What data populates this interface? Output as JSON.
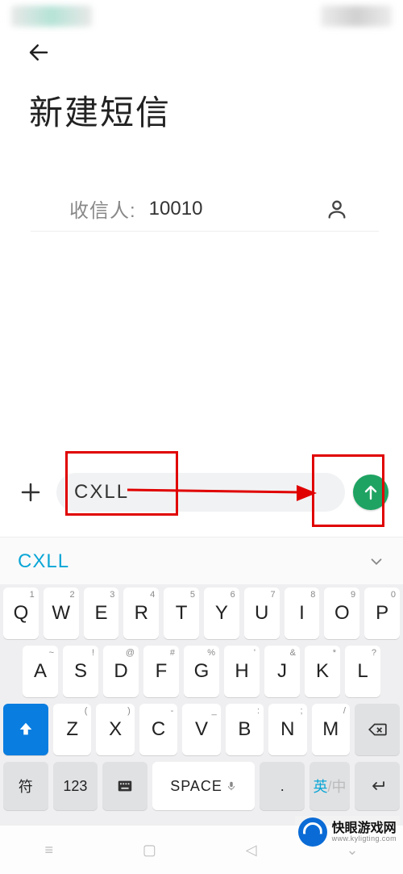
{
  "header": {
    "title": "新建短信"
  },
  "recipient": {
    "label": "收信人:",
    "value": "10010"
  },
  "compose": {
    "text": "CXLL"
  },
  "suggestion": {
    "text": "CXLL"
  },
  "keyboard": {
    "row1": [
      {
        "k": "Q",
        "m": "1"
      },
      {
        "k": "W",
        "m": "2"
      },
      {
        "k": "E",
        "m": "3"
      },
      {
        "k": "R",
        "m": "4"
      },
      {
        "k": "T",
        "m": "5"
      },
      {
        "k": "Y",
        "m": "6"
      },
      {
        "k": "U",
        "m": "7"
      },
      {
        "k": "I",
        "m": "8"
      },
      {
        "k": "O",
        "m": "9"
      },
      {
        "k": "P",
        "m": "0"
      }
    ],
    "row2": [
      {
        "k": "A",
        "m": "~"
      },
      {
        "k": "S",
        "m": "!"
      },
      {
        "k": "D",
        "m": "@"
      },
      {
        "k": "F",
        "m": "#"
      },
      {
        "k": "G",
        "m": "%"
      },
      {
        "k": "H",
        "m": "'"
      },
      {
        "k": "J",
        "m": "&"
      },
      {
        "k": "K",
        "m": "*"
      },
      {
        "k": "L",
        "m": "?"
      }
    ],
    "row3": [
      {
        "k": "Z",
        "m": "("
      },
      {
        "k": "X",
        "m": ")"
      },
      {
        "k": "C",
        "m": "-"
      },
      {
        "k": "V",
        "m": "_"
      },
      {
        "k": "B",
        "m": ":"
      },
      {
        "k": "N",
        "m": ";"
      },
      {
        "k": "M",
        "m": "/"
      }
    ],
    "row4": {
      "sym": "符",
      "num": "123",
      "space": "SPACE",
      "period": ".",
      "lang_active": "英",
      "lang_inactive": "/中"
    }
  },
  "watermark": {
    "name": "快眼游戏网",
    "url": "www.kyligting.com"
  }
}
